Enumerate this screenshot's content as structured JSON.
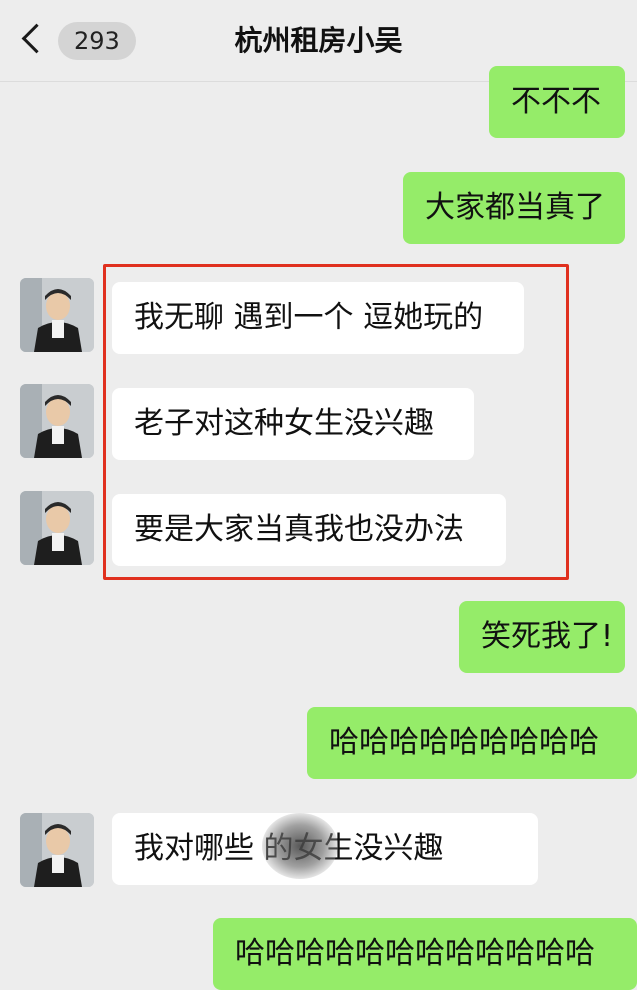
{
  "header": {
    "back_icon": "chevron-left-icon",
    "unread_count": "293",
    "title": "杭州租房小吴"
  },
  "messages": [
    {
      "side": "out",
      "text": "不不不"
    },
    {
      "side": "out",
      "text": "大家都当真了"
    },
    {
      "side": "in",
      "text": "我无聊 遇到一个 逗她玩的"
    },
    {
      "side": "in",
      "text": "老子对这种女生没兴趣"
    },
    {
      "side": "in",
      "text": "要是大家当真我也没办法"
    },
    {
      "side": "out",
      "text": "笑死我了!"
    },
    {
      "side": "out",
      "text": "哈哈哈哈哈哈哈哈哈"
    },
    {
      "side": "in",
      "text": "我对哪些 的女生没兴趣"
    },
    {
      "side": "out",
      "text": "哈哈哈哈哈哈哈哈哈哈哈哈"
    }
  ],
  "colors": {
    "background": "#ededed",
    "outgoing_bubble": "#95ec69",
    "incoming_bubble": "#ffffff",
    "highlight_border": "#e0301e"
  }
}
